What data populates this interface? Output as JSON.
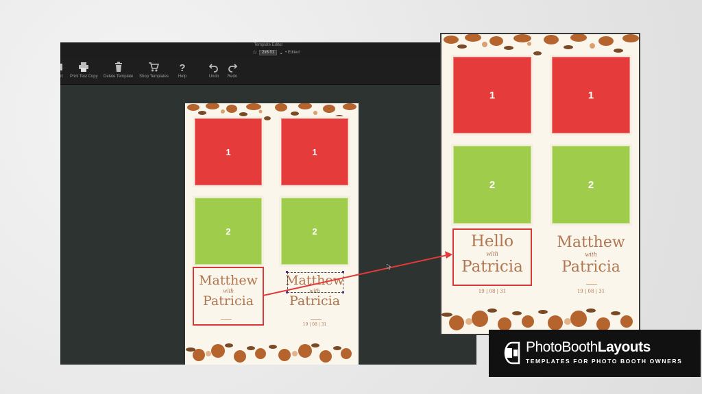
{
  "window": {
    "title": "Template Editor",
    "template_name": "2x6 01",
    "status": "• Edited"
  },
  "toolbar": {
    "items": [
      {
        "label": "rt",
        "icon": "export-icon"
      },
      {
        "label": "Print Test Copy",
        "icon": "printer-icon"
      },
      {
        "label": "Delete Template",
        "icon": "trash-icon"
      },
      {
        "label": "Shop Templates",
        "icon": "cart-icon"
      },
      {
        "label": "Help",
        "icon": "help-icon"
      },
      {
        "label": "Undo",
        "icon": "undo-icon"
      },
      {
        "label": "Redo",
        "icon": "redo-icon"
      }
    ]
  },
  "template": {
    "photo_1": "1",
    "photo_2": "2",
    "name_top": "Matthew",
    "connector": "with",
    "name_bottom": "Patricia",
    "date": "19 | 08 | 31",
    "photo_1_color": "#e53b3b",
    "photo_2_color": "#9fcc4a"
  },
  "preview": {
    "photo_1": "1",
    "photo_2": "2",
    "left_top": "Hello",
    "left_connector": "with",
    "left_bottom": "Patricia",
    "right_top": "Matthew",
    "right_connector": "with",
    "right_bottom": "Patricia",
    "date": "19 | 08 | 31"
  },
  "annotation": {
    "arrow_color": "#e23a3a"
  },
  "logo": {
    "brand_light": "PhotoBooth",
    "brand_bold": "Layouts",
    "tagline": "TEMPLATES FOR PHOTO BOOTH OWNERS"
  }
}
